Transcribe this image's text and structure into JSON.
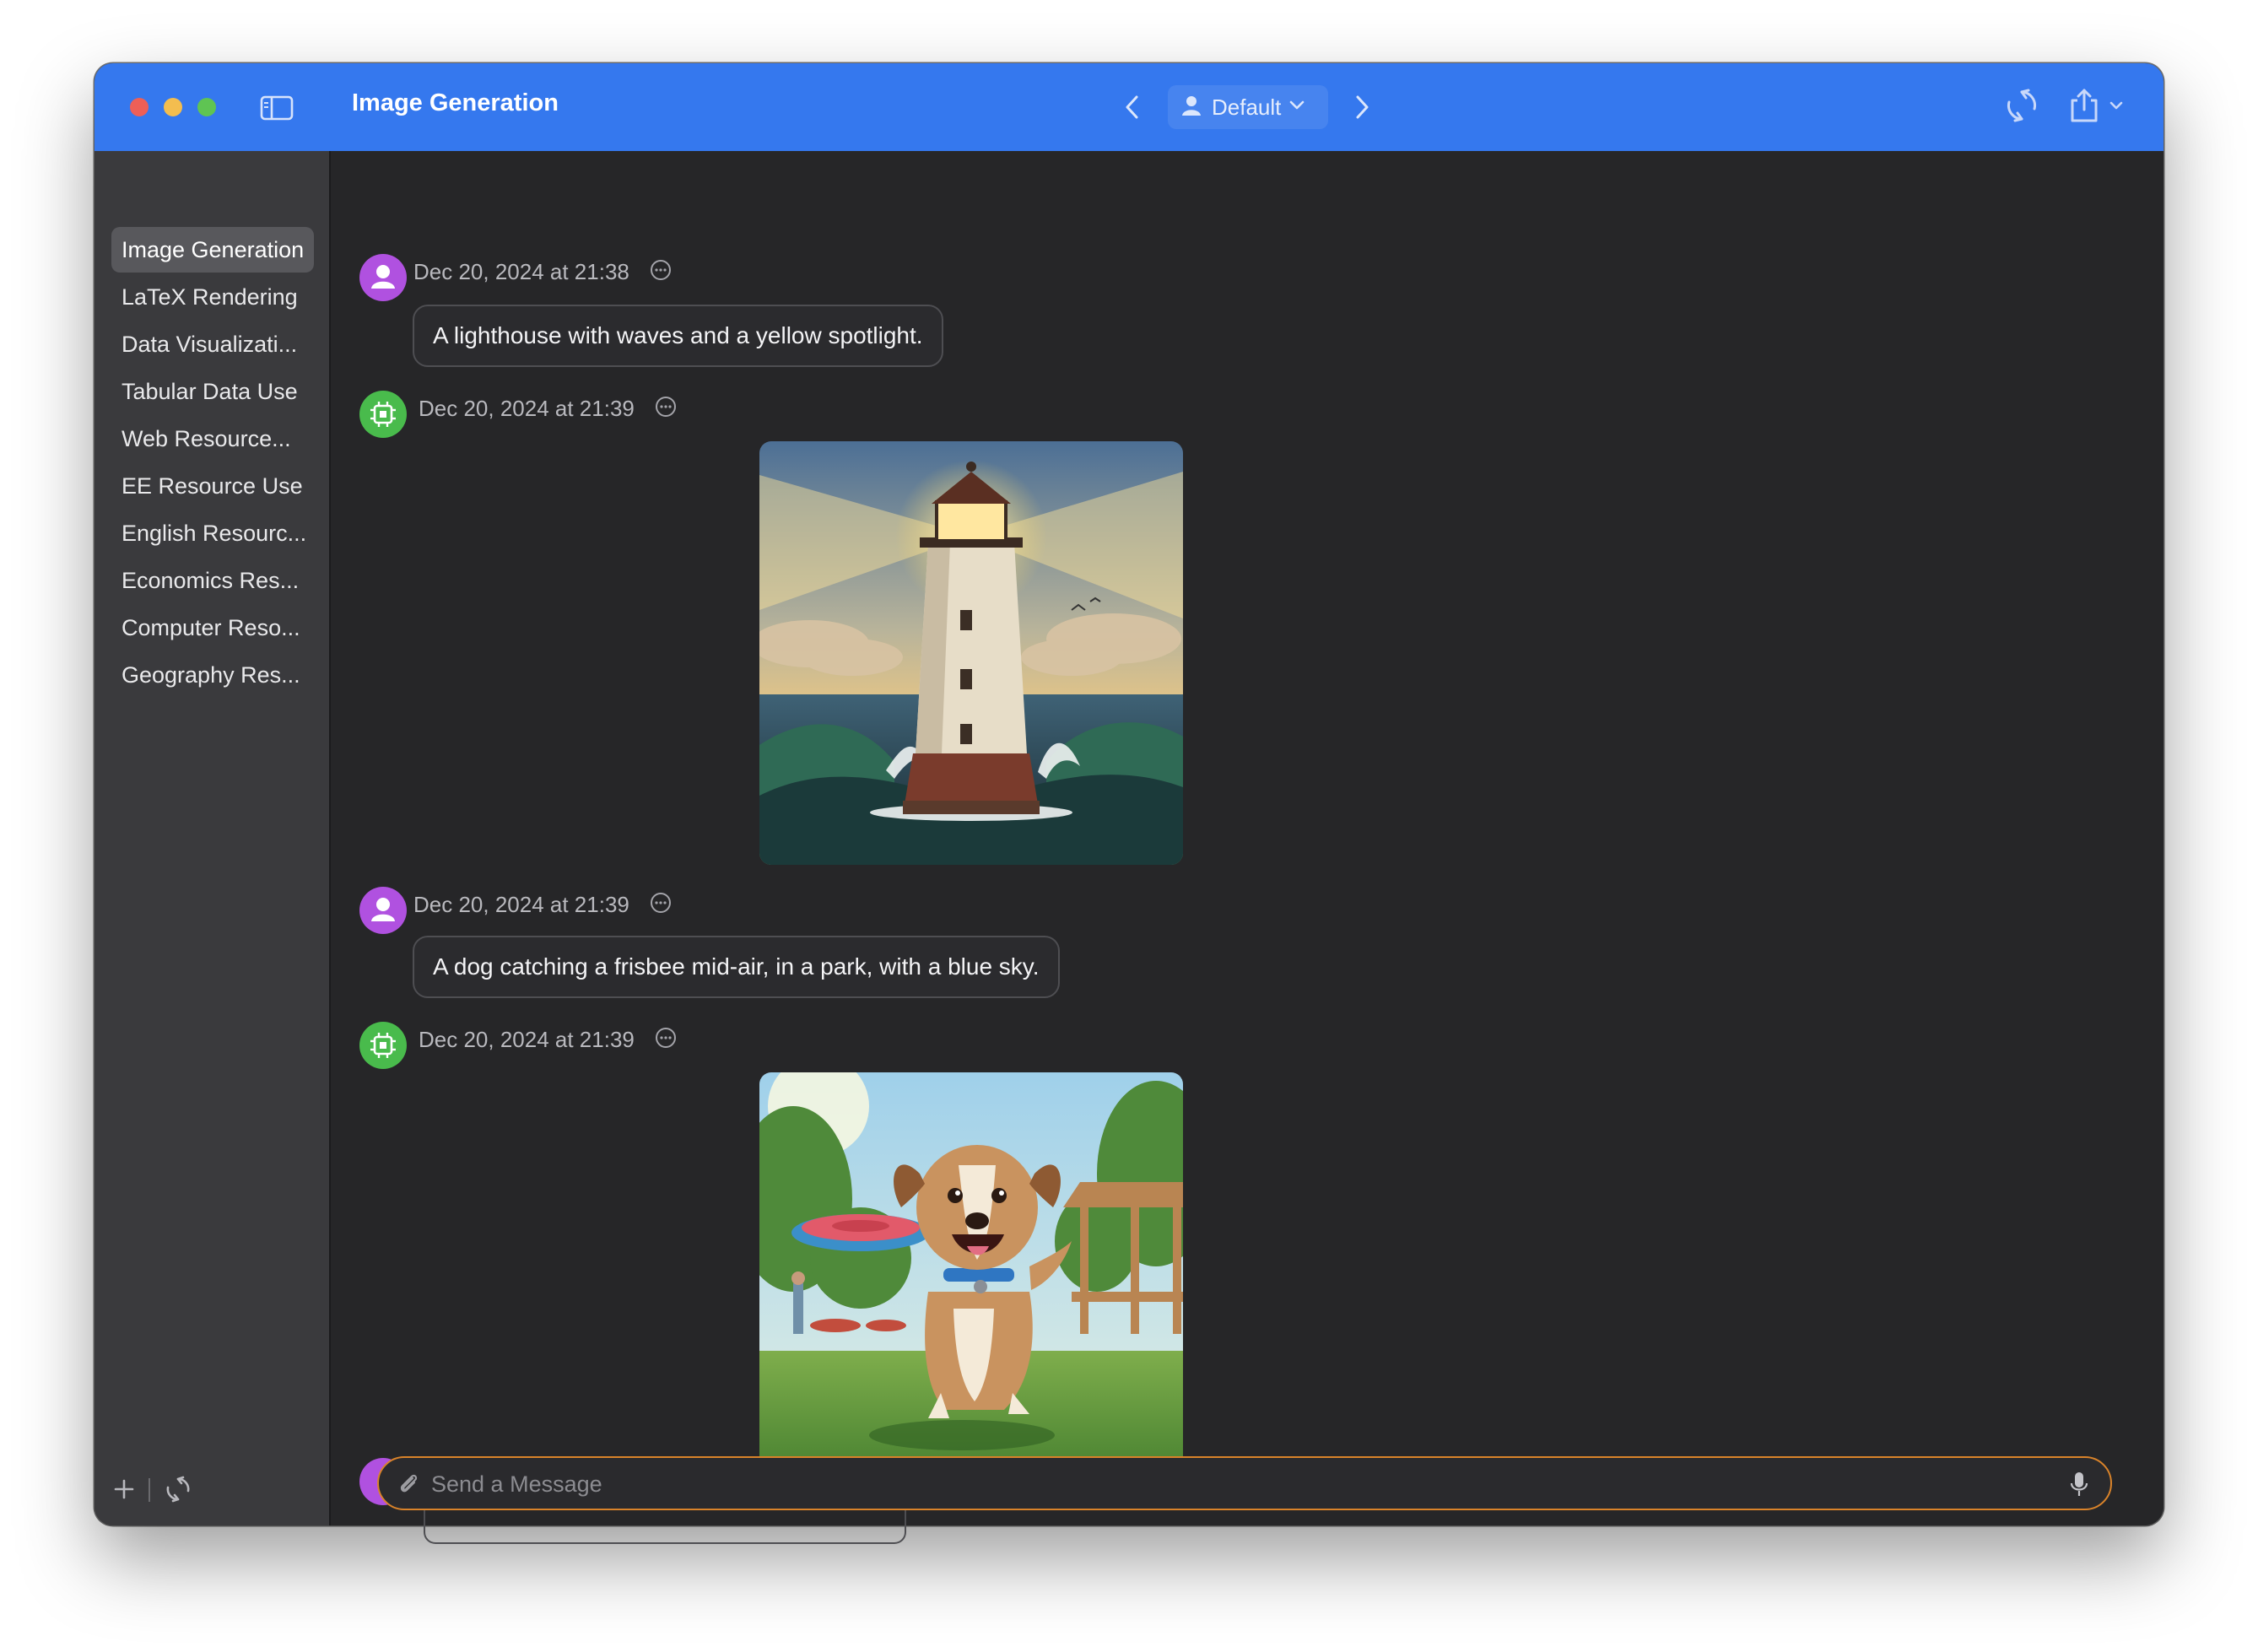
{
  "window": {
    "title": "Image Generation",
    "profile": "Default"
  },
  "sidebar": {
    "items": [
      {
        "label": "Image Generation",
        "active": true
      },
      {
        "label": "LaTeX Rendering"
      },
      {
        "label": "Data Visualizati..."
      },
      {
        "label": "Tabular Data Use"
      },
      {
        "label": "Web Resource..."
      },
      {
        "label": "EE Resource Use"
      },
      {
        "label": "English Resourc..."
      },
      {
        "label": "Economics Res..."
      },
      {
        "label": "Computer Reso..."
      },
      {
        "label": "Geography Res..."
      }
    ]
  },
  "messages": [
    {
      "role": "user",
      "timestamp": "Dec 20, 2024 at 21:38",
      "text": "A lighthouse with waves and a yellow spotlight."
    },
    {
      "role": "assistant",
      "timestamp": "Dec 20, 2024 at 21:39",
      "image": "lighthouse-image"
    },
    {
      "role": "user",
      "timestamp": "Dec 20, 2024 at 21:39",
      "text": "A dog catching a frisbee mid-air, in a park, with a blue sky."
    },
    {
      "role": "assistant",
      "timestamp": "Dec 20, 2024 at 21:39",
      "image": "dog-frisbee-image"
    }
  ],
  "composer": {
    "placeholder": "Send a Message"
  },
  "colors": {
    "titlebar": "#3578ee",
    "user_avatar": "#b051e0",
    "assistant_avatar": "#49bb4c",
    "composer_border": "#d9832a"
  },
  "icons": [
    "sidebar-toggle-icon",
    "chevron-left-icon",
    "person-icon",
    "chevron-down-icon",
    "chevron-right-icon",
    "refresh-icon",
    "share-icon",
    "plus-icon",
    "sync-icon",
    "more-icon",
    "paperclip-icon",
    "microphone-icon"
  ]
}
